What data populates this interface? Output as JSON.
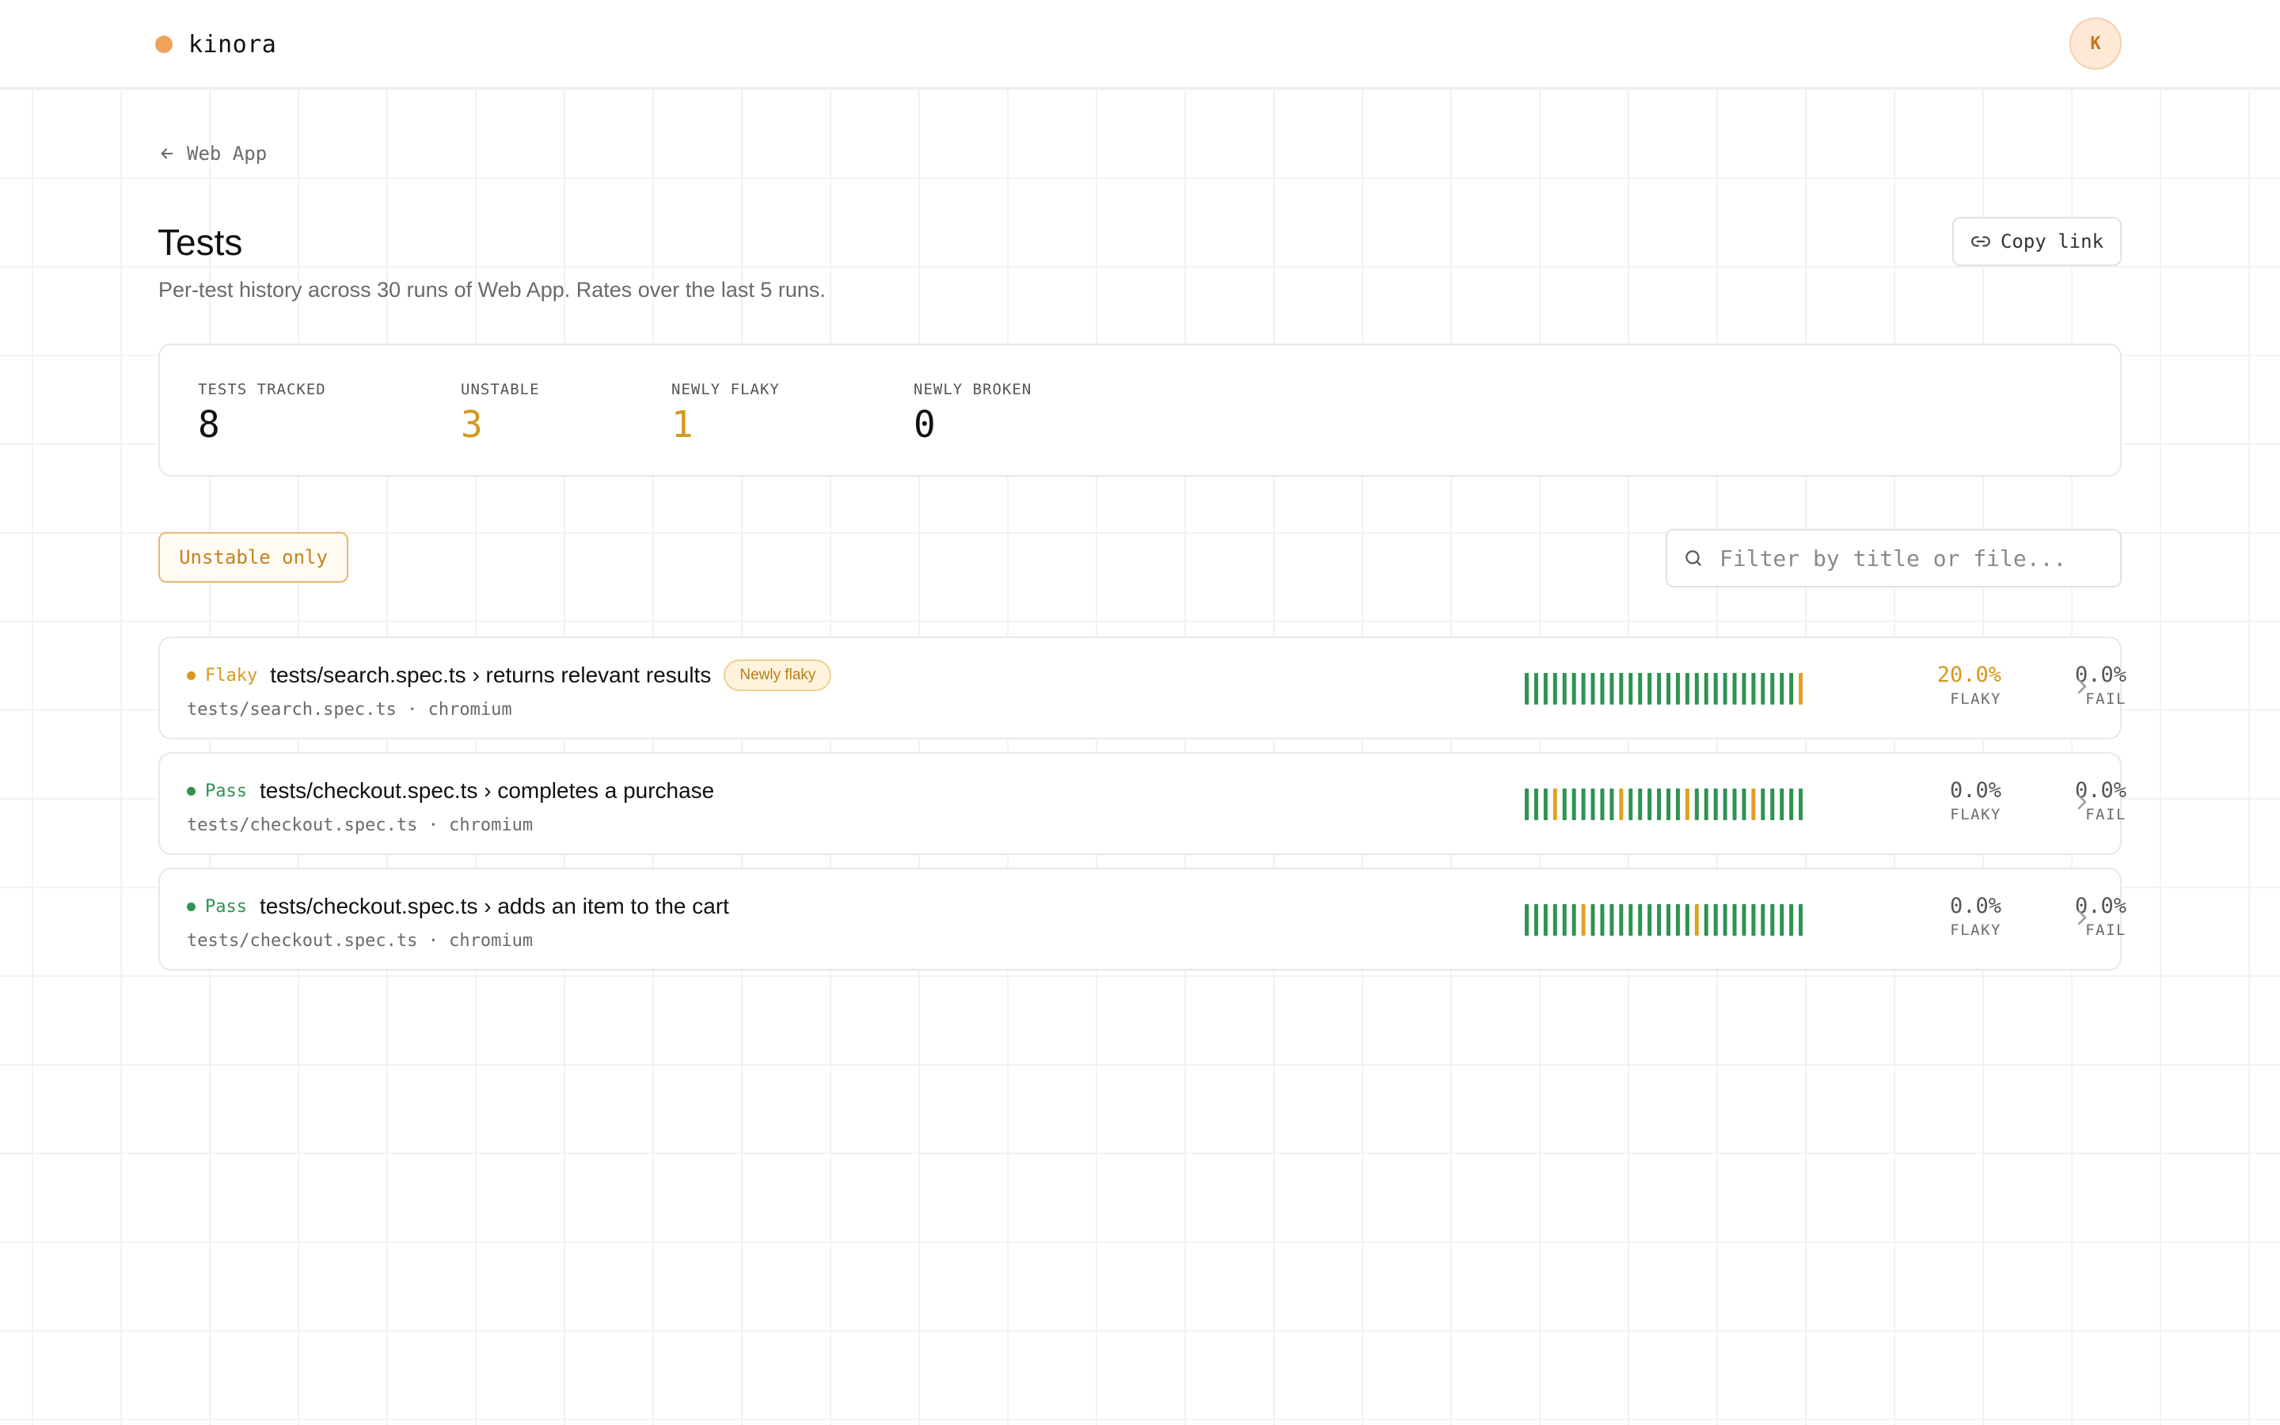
{
  "colors": {
    "accent": "#f0a25a",
    "pass": "#2e9350",
    "flaky": "#e0a125",
    "warning_text": "#d4991e"
  },
  "brand": {
    "name": "kinora"
  },
  "user": {
    "avatar_initial": "K"
  },
  "nav": {
    "back_label": "Web App",
    "back_icon": "arrow-left-icon"
  },
  "page": {
    "title": "Tests",
    "subtitle": "Per-test history across 30 runs of Web App. Rates over the last 5 runs.",
    "copy_link_label": "Copy link",
    "copy_link_icon": "link-icon"
  },
  "stats": [
    {
      "label": "TESTS TRACKED",
      "value": "8",
      "color": "#111111"
    },
    {
      "label": "UNSTABLE",
      "value": "3",
      "color": "#d4991e"
    },
    {
      "label": "NEWLY FLAKY",
      "value": "1",
      "color": "#d4991e"
    },
    {
      "label": "NEWLY BROKEN",
      "value": "0",
      "color": "#111111"
    }
  ],
  "filters": {
    "unstable_only_label": "Unstable only",
    "search_placeholder": "Filter by title or file...",
    "search_value": ""
  },
  "tests": [
    {
      "status": "Flaky",
      "status_color": "#d4991e",
      "title": "tests/search.spec.ts › returns relevant results",
      "badge": "Newly flaky",
      "file": "tests/search.spec.ts",
      "browser": "chromium",
      "subtitle": "tests/search.spec.ts · chromium",
      "history": [
        "pass",
        "pass",
        "pass",
        "pass",
        "pass",
        "pass",
        "pass",
        "pass",
        "pass",
        "pass",
        "pass",
        "pass",
        "pass",
        "pass",
        "pass",
        "pass",
        "pass",
        "pass",
        "pass",
        "pass",
        "pass",
        "pass",
        "pass",
        "pass",
        "pass",
        "pass",
        "pass",
        "pass",
        "pass",
        "flaky"
      ],
      "flaky_rate": "20.0%",
      "flaky_color": "#d4991e",
      "fail_rate": "0.0%",
      "flaky_label": "FLAKY",
      "fail_label": "FAIL"
    },
    {
      "status": "Pass",
      "status_color": "#2e9350",
      "title": "tests/checkout.spec.ts › completes a purchase",
      "badge": "",
      "file": "tests/checkout.spec.ts",
      "browser": "chromium",
      "subtitle": "tests/checkout.spec.ts · chromium",
      "history": [
        "pass",
        "pass",
        "pass",
        "flaky",
        "pass",
        "pass",
        "pass",
        "pass",
        "pass",
        "pass",
        "flaky",
        "pass",
        "pass",
        "pass",
        "pass",
        "pass",
        "pass",
        "flaky",
        "pass",
        "pass",
        "pass",
        "pass",
        "pass",
        "pass",
        "flaky",
        "pass",
        "pass",
        "pass",
        "pass",
        "pass"
      ],
      "flaky_rate": "0.0%",
      "flaky_color": "#555555",
      "fail_rate": "0.0%",
      "flaky_label": "FLAKY",
      "fail_label": "FAIL"
    },
    {
      "status": "Pass",
      "status_color": "#2e9350",
      "title": "tests/checkout.spec.ts › adds an item to the cart",
      "badge": "",
      "file": "tests/checkout.spec.ts",
      "browser": "chromium",
      "subtitle": "tests/checkout.spec.ts · chromium",
      "history": [
        "pass",
        "pass",
        "pass",
        "pass",
        "pass",
        "pass",
        "flaky",
        "pass",
        "pass",
        "pass",
        "pass",
        "pass",
        "pass",
        "pass",
        "pass",
        "pass",
        "pass",
        "pass",
        "flaky",
        "pass",
        "pass",
        "pass",
        "pass",
        "pass",
        "pass",
        "pass",
        "pass",
        "pass",
        "pass",
        "pass"
      ],
      "flaky_rate": "0.0%",
      "flaky_color": "#555555",
      "fail_rate": "0.0%",
      "flaky_label": "FLAKY",
      "fail_label": "FAIL"
    }
  ]
}
